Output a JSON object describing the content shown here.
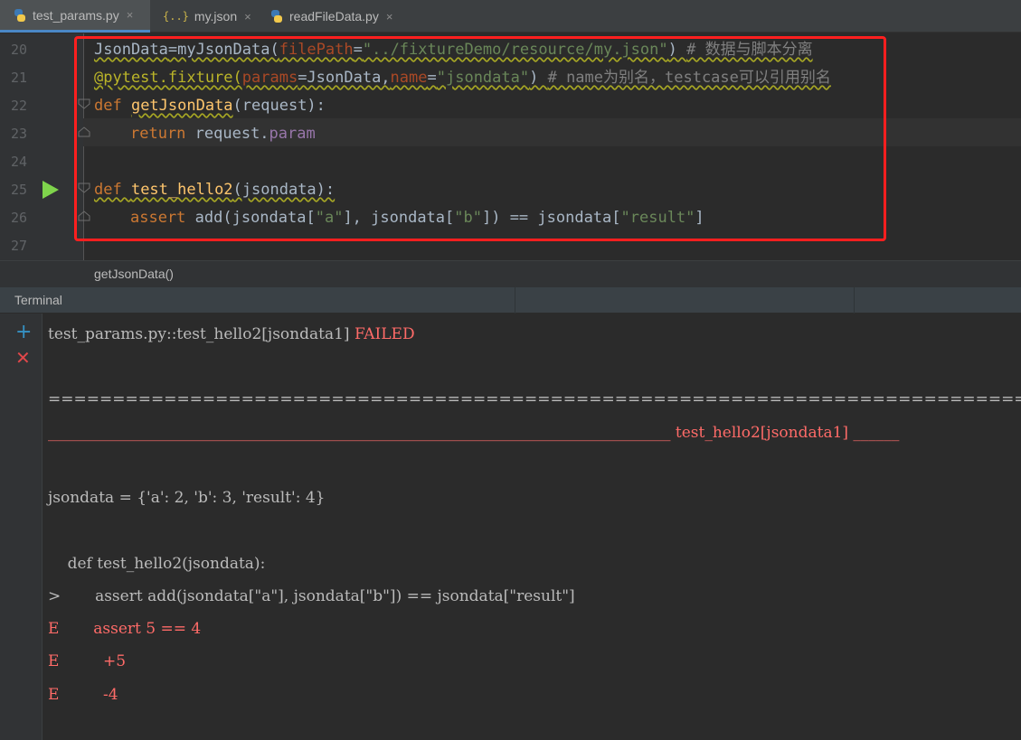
{
  "tabs": [
    {
      "label": "test_params.py",
      "icon": "python-file-icon",
      "active": true
    },
    {
      "label": "my.json",
      "icon": "json-file-icon",
      "active": false
    },
    {
      "label": "readFileData.py",
      "icon": "python-file-icon",
      "active": false
    }
  ],
  "tab_close_glyph": "×",
  "json_icon_glyph": "{..}",
  "editor": {
    "line_numbers": [
      "20",
      "21",
      "22",
      "23",
      "24",
      "25",
      "26",
      "27"
    ],
    "lines": {
      "l20": {
        "a": "JsonData",
        "b": "=myJsonData(",
        "c": "filePath",
        "d": "=",
        "e": "\"../fixtureDemo/resource/my.json\"",
        "f": ") ",
        "g": "# 数据与脚本分离"
      },
      "l21": {
        "a": "@pytest.fixture(",
        "b": "params",
        "c": "=JsonData,",
        "d": "name",
        "e": "=",
        "f": "\"jsondata\"",
        "g": ") ",
        "h": "# name为别名，testcase可以引用别名"
      },
      "l22": {
        "a": "def ",
        "b": "getJsonData",
        "c": "(request):"
      },
      "l23": {
        "a": "return ",
        "b": "request.",
        "c": "param"
      },
      "l25": {
        "a": "def ",
        "b": "test_hello2",
        "c": "(jsondata):"
      },
      "l26": {
        "a": "assert ",
        "b": "add(jsondata[",
        "c": "\"a\"",
        "d": "], jsondata[",
        "e": "\"b\"",
        "f": "]) == jsondata[",
        "g": "\"result\"",
        "h": "]"
      }
    }
  },
  "breadcrumb": "getJsonData()",
  "terminal": {
    "title": "Terminal",
    "new_session": "+",
    "close_session": "✕",
    "lines": {
      "result_prefix": "test_params.py::test_hello2[jsondata1] ",
      "result_status": "FAILED",
      "failures_header": "===================================================================================== FAILURES ==============",
      "test_header": "_________________________________________________________________________________ test_hello2[jsondata1] ______",
      "jsondata": "jsondata = {'a': 2, 'b': 3, 'result': 4}",
      "def_line": "    def test_hello2(jsondata):",
      "assert_line": ">       assert add(jsondata[\"a\"], jsondata[\"b\"]) == jsondata[\"result\"]",
      "e1": "E       assert 5 == 4",
      "e2": "E         +5",
      "e3": "E         -4"
    }
  },
  "colors": {
    "highlight_box": "#ff1f1f",
    "run_icon": "#7fd44c",
    "failed": "#ff6b68"
  }
}
